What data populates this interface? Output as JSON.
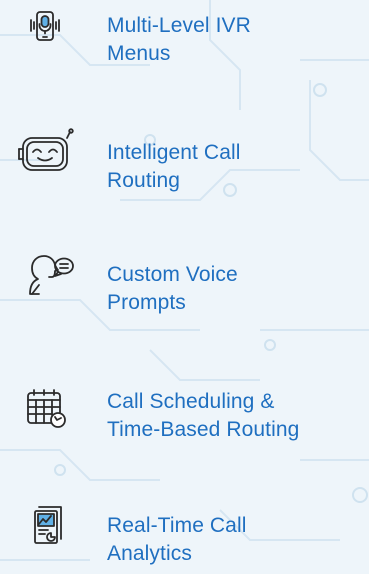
{
  "features": [
    {
      "icon": "phone-microphone-icon",
      "label_line1": "Multi-Level IVR",
      "label_line2": "Menus"
    },
    {
      "icon": "robot-face-icon",
      "label_line1": "Intelligent Call",
      "label_line2": "Routing"
    },
    {
      "icon": "speaking-person-icon",
      "label_line1": "Custom Voice",
      "label_line2": "Prompts"
    },
    {
      "icon": "calendar-clock-icon",
      "label_line1": "Call Scheduling &",
      "label_line2": "Time-Based Routing"
    },
    {
      "icon": "analytics-report-icon",
      "label_line1": "Real-Time Call",
      "label_line2": "Analytics"
    }
  ],
  "colors": {
    "text": "#1f6fc0",
    "icon_stroke": "#2b2b2b",
    "background": "#eef5fa",
    "circuit": "#d4e5f1"
  }
}
